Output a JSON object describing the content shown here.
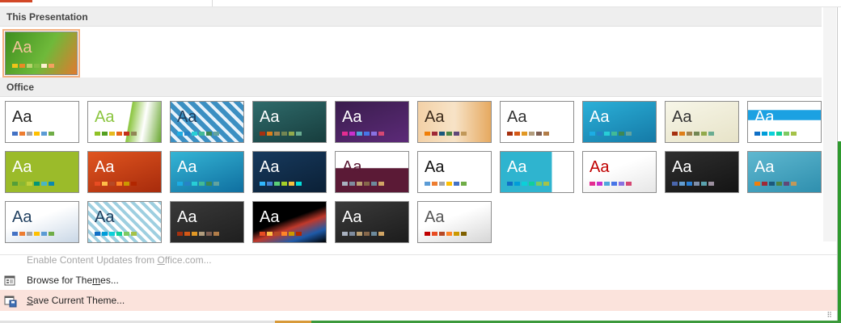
{
  "sections": {
    "this_presentation": "This Presentation",
    "office": "Office"
  },
  "current_theme": {
    "label": "Aa",
    "bg": "linear-gradient(120deg,#3f8f1f 0%,#6fb93a 55%,#e07a2f 100%)",
    "text_color": "#f2c59a",
    "swatches": [
      "#f0c419",
      "#e88b25",
      "#b8d26c",
      "#84bd45",
      "#fdf0d0",
      "#f5a05f"
    ]
  },
  "themes": [
    {
      "label": "Aa",
      "bg": "#ffffff",
      "text_color": "#222222",
      "swatches": [
        "#4472c4",
        "#ed7d31",
        "#a5a5a5",
        "#ffc000",
        "#5b9bd5",
        "#70ad47"
      ]
    },
    {
      "label": "Aa",
      "bg": "linear-gradient(100deg,#ffffff 55%,#8bc53f 56%,#ffffff 75%,#6aa832 100%)",
      "text_color": "#8bc53f",
      "swatches": [
        "#90c226",
        "#54a021",
        "#e6b91e",
        "#e76618",
        "#c42f1a",
        "#918655"
      ]
    },
    {
      "label": "Aa",
      "bg": "repeating-linear-gradient(45deg,#3b8fc2 0 6px,#e9f3fb 6px 10px)",
      "text_color": "#1f3f5f",
      "swatches": [
        "#1cade4",
        "#2683c6",
        "#27ced7",
        "#42ba97",
        "#3e8853",
        "#62a39f"
      ]
    },
    {
      "label": "Aa",
      "bg": "linear-gradient(160deg,#2f6b6b,#173d3d)",
      "text_color": "#ffffff",
      "swatches": [
        "#a53010",
        "#de7e18",
        "#9f8351",
        "#728653",
        "#92aa4c",
        "#6aac91"
      ]
    },
    {
      "label": "Aa",
      "bg": "linear-gradient(160deg,#3a1d4d,#5c2a78)",
      "text_color": "#ffffff",
      "swatches": [
        "#e32d91",
        "#c830cc",
        "#4ea6dc",
        "#4775e7",
        "#8971e1",
        "#d54773"
      ]
    },
    {
      "label": "Aa",
      "bg": "linear-gradient(90deg,#f3d1a7 0%,#f7e3c7 50%,#e6a960 100%)",
      "text_color": "#3b2a1a",
      "swatches": [
        "#f07f09",
        "#9f2936",
        "#1b587c",
        "#4e8542",
        "#604878",
        "#c19859"
      ]
    },
    {
      "label": "Aa",
      "bg": "#ffffff",
      "text_color": "#333333",
      "swatches": [
        "#a5300f",
        "#d55816",
        "#e19825",
        "#b19c7d",
        "#7f5f52",
        "#b27d49"
      ]
    },
    {
      "label": "Aa",
      "bg": "linear-gradient(160deg,#2bb0d8,#157aa7)",
      "text_color": "#ffffff",
      "swatches": [
        "#1cade4",
        "#2683c6",
        "#27ced7",
        "#42ba97",
        "#3e8853",
        "#62a39f"
      ]
    },
    {
      "label": "Aa",
      "bg": "linear-gradient(160deg,#f7f6e8,#e7e3c8)",
      "text_color": "#333333",
      "swatches": [
        "#a53010",
        "#de7e18",
        "#9f8351",
        "#728653",
        "#92aa4c",
        "#6aac91"
      ]
    },
    {
      "label": "Aa",
      "bg": "linear-gradient(180deg,#ffffff 20%,#1ba1e2 21%,#1ba1e2 45%,#ffffff 46%)",
      "text_color": "#ffffff",
      "swatches": [
        "#0f6fc6",
        "#009dd9",
        "#0bd0d9",
        "#10cf9b",
        "#7cca62",
        "#a5c249"
      ]
    },
    {
      "label": "Aa",
      "bg": "#9bbb2a",
      "text_color": "#ffffff",
      "swatches": [
        "#549e39",
        "#8ab833",
        "#c0cf3a",
        "#029676",
        "#4ab5c4",
        "#0989b1"
      ]
    },
    {
      "label": "Aa",
      "bg": "linear-gradient(160deg,#e0551f,#a72b0c)",
      "text_color": "#ffffff",
      "swatches": [
        "#e84c22",
        "#ffbd47",
        "#b64926",
        "#ff8427",
        "#cc9900",
        "#b22600"
      ]
    },
    {
      "label": "Aa",
      "bg": "linear-gradient(160deg,#35b5d5,#0f6fa0)",
      "text_color": "#ffffff",
      "swatches": [
        "#1cade4",
        "#2683c6",
        "#27ced7",
        "#42ba97",
        "#3e8853",
        "#62a39f"
      ]
    },
    {
      "label": "Aa",
      "bg": "linear-gradient(160deg,#173a5e,#0b2036)",
      "text_color": "#ffffff",
      "swatches": [
        "#31b6fd",
        "#4584d3",
        "#5bd078",
        "#a5d028",
        "#f5c040",
        "#05e0db"
      ]
    },
    {
      "label": "Aa",
      "bg": "linear-gradient(180deg,#ffffff 40%,#5b1a36 41%)",
      "text_color": "#5b1a36",
      "swatches": [
        "#a9b1bf",
        "#7f8c9e",
        "#bda174",
        "#87684b",
        "#6d8a9c",
        "#d1a565"
      ]
    },
    {
      "label": "Aa",
      "bg": "#ffffff",
      "text_color": "#111111",
      "swatches": [
        "#5b9bd5",
        "#ed7d31",
        "#a5a5a5",
        "#ffc000",
        "#4472c4",
        "#70ad47"
      ]
    },
    {
      "label": "Aa",
      "bg": "linear-gradient(90deg,#2fb4cf 70%,#ffffff 71%)",
      "text_color": "#ffffff",
      "swatches": [
        "#0f6fc6",
        "#009dd9",
        "#0bd0d9",
        "#10cf9b",
        "#7cca62",
        "#a5c249"
      ]
    },
    {
      "label": "Aa",
      "bg": "linear-gradient(160deg,#ffffff 40%,#e6e6e6 100%)",
      "text_color": "#c00000",
      "swatches": [
        "#e32d91",
        "#c830cc",
        "#4ea6dc",
        "#4775e7",
        "#8971e1",
        "#d54773"
      ]
    },
    {
      "label": "Aa",
      "bg": "linear-gradient(160deg,#2f2f2f,#141414)",
      "text_color": "#ffffff",
      "swatches": [
        "#4a66ac",
        "#629dd1",
        "#297fd5",
        "#7f8fa9",
        "#5aa2ae",
        "#9d90a0"
      ]
    },
    {
      "label": "Aa",
      "bg": "linear-gradient(160deg,#5fb8d0,#2f8fae)",
      "text_color": "#ffffff",
      "swatches": [
        "#f07f09",
        "#9f2936",
        "#1b587c",
        "#4e8542",
        "#604878",
        "#c19859"
      ]
    },
    {
      "label": "Aa",
      "bg": "linear-gradient(160deg,#ffffff 40%,#c9d7e6 100%)",
      "text_color": "#1f3f5f",
      "swatches": [
        "#4472c4",
        "#ed7d31",
        "#a5a5a5",
        "#ffc000",
        "#5b9bd5",
        "#70ad47"
      ]
    },
    {
      "label": "Aa",
      "bg": "repeating-linear-gradient(45deg,#9ecfe0 0 4px,#ffffff 4px 8px)",
      "text_color": "#1f3f5f",
      "swatches": [
        "#0f6fc6",
        "#009dd9",
        "#0bd0d9",
        "#10cf9b",
        "#7cca62",
        "#a5c249"
      ]
    },
    {
      "label": "Aa",
      "bg": "linear-gradient(160deg,#3a3a3a,#1f1f1f)",
      "text_color": "#ffffff",
      "swatches": [
        "#a5300f",
        "#d55816",
        "#e19825",
        "#b19c7d",
        "#7f5f52",
        "#b27d49"
      ]
    },
    {
      "label": "Aa",
      "bg": "linear-gradient(160deg,#000000 45%,#c0392b 60%,#1e5aa8 80%,#000000 100%)",
      "text_color": "#ffffff",
      "swatches": [
        "#e84c22",
        "#ffbd47",
        "#b64926",
        "#ff8427",
        "#cc9900",
        "#b22600"
      ]
    },
    {
      "label": "Aa",
      "bg": "linear-gradient(160deg,#3b3b3b,#1c1c1c)",
      "text_color": "#ffffff",
      "swatches": [
        "#a9b1bf",
        "#7f8c9e",
        "#bda174",
        "#87684b",
        "#6d8a9c",
        "#d1a565"
      ]
    },
    {
      "label": "Aa",
      "bg": "linear-gradient(160deg,#ffffff 40%,#d6d6d6 100%)",
      "text_color": "#555555",
      "swatches": [
        "#c00000",
        "#e84c22",
        "#b64926",
        "#ff8427",
        "#cc9900",
        "#7f6000"
      ]
    }
  ],
  "menu": {
    "enable_updates": "Enable Content Updates from Office.com...",
    "browse": "Browse for Themes...",
    "save": "Save Current Theme..."
  }
}
